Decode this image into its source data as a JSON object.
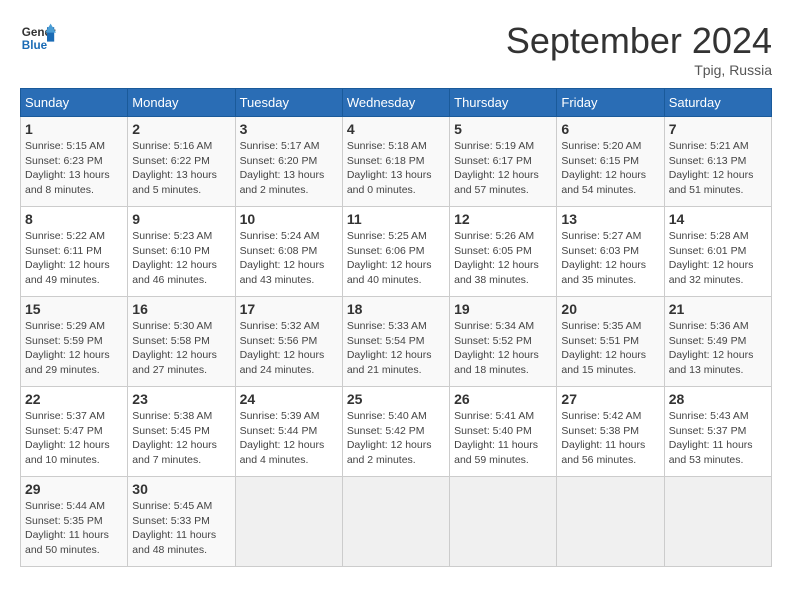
{
  "header": {
    "logo_line1": "General",
    "logo_line2": "Blue",
    "month_title": "September 2024",
    "location": "Tpig, Russia"
  },
  "weekdays": [
    "Sunday",
    "Monday",
    "Tuesday",
    "Wednesday",
    "Thursday",
    "Friday",
    "Saturday"
  ],
  "weeks": [
    [
      {
        "day": "1",
        "info": "Sunrise: 5:15 AM\nSunset: 6:23 PM\nDaylight: 13 hours\nand 8 minutes."
      },
      {
        "day": "2",
        "info": "Sunrise: 5:16 AM\nSunset: 6:22 PM\nDaylight: 13 hours\nand 5 minutes."
      },
      {
        "day": "3",
        "info": "Sunrise: 5:17 AM\nSunset: 6:20 PM\nDaylight: 13 hours\nand 2 minutes."
      },
      {
        "day": "4",
        "info": "Sunrise: 5:18 AM\nSunset: 6:18 PM\nDaylight: 13 hours\nand 0 minutes."
      },
      {
        "day": "5",
        "info": "Sunrise: 5:19 AM\nSunset: 6:17 PM\nDaylight: 12 hours\nand 57 minutes."
      },
      {
        "day": "6",
        "info": "Sunrise: 5:20 AM\nSunset: 6:15 PM\nDaylight: 12 hours\nand 54 minutes."
      },
      {
        "day": "7",
        "info": "Sunrise: 5:21 AM\nSunset: 6:13 PM\nDaylight: 12 hours\nand 51 minutes."
      }
    ],
    [
      {
        "day": "8",
        "info": "Sunrise: 5:22 AM\nSunset: 6:11 PM\nDaylight: 12 hours\nand 49 minutes."
      },
      {
        "day": "9",
        "info": "Sunrise: 5:23 AM\nSunset: 6:10 PM\nDaylight: 12 hours\nand 46 minutes."
      },
      {
        "day": "10",
        "info": "Sunrise: 5:24 AM\nSunset: 6:08 PM\nDaylight: 12 hours\nand 43 minutes."
      },
      {
        "day": "11",
        "info": "Sunrise: 5:25 AM\nSunset: 6:06 PM\nDaylight: 12 hours\nand 40 minutes."
      },
      {
        "day": "12",
        "info": "Sunrise: 5:26 AM\nSunset: 6:05 PM\nDaylight: 12 hours\nand 38 minutes."
      },
      {
        "day": "13",
        "info": "Sunrise: 5:27 AM\nSunset: 6:03 PM\nDaylight: 12 hours\nand 35 minutes."
      },
      {
        "day": "14",
        "info": "Sunrise: 5:28 AM\nSunset: 6:01 PM\nDaylight: 12 hours\nand 32 minutes."
      }
    ],
    [
      {
        "day": "15",
        "info": "Sunrise: 5:29 AM\nSunset: 5:59 PM\nDaylight: 12 hours\nand 29 minutes."
      },
      {
        "day": "16",
        "info": "Sunrise: 5:30 AM\nSunset: 5:58 PM\nDaylight: 12 hours\nand 27 minutes."
      },
      {
        "day": "17",
        "info": "Sunrise: 5:32 AM\nSunset: 5:56 PM\nDaylight: 12 hours\nand 24 minutes."
      },
      {
        "day": "18",
        "info": "Sunrise: 5:33 AM\nSunset: 5:54 PM\nDaylight: 12 hours\nand 21 minutes."
      },
      {
        "day": "19",
        "info": "Sunrise: 5:34 AM\nSunset: 5:52 PM\nDaylight: 12 hours\nand 18 minutes."
      },
      {
        "day": "20",
        "info": "Sunrise: 5:35 AM\nSunset: 5:51 PM\nDaylight: 12 hours\nand 15 minutes."
      },
      {
        "day": "21",
        "info": "Sunrise: 5:36 AM\nSunset: 5:49 PM\nDaylight: 12 hours\nand 13 minutes."
      }
    ],
    [
      {
        "day": "22",
        "info": "Sunrise: 5:37 AM\nSunset: 5:47 PM\nDaylight: 12 hours\nand 10 minutes."
      },
      {
        "day": "23",
        "info": "Sunrise: 5:38 AM\nSunset: 5:45 PM\nDaylight: 12 hours\nand 7 minutes."
      },
      {
        "day": "24",
        "info": "Sunrise: 5:39 AM\nSunset: 5:44 PM\nDaylight: 12 hours\nand 4 minutes."
      },
      {
        "day": "25",
        "info": "Sunrise: 5:40 AM\nSunset: 5:42 PM\nDaylight: 12 hours\nand 2 minutes."
      },
      {
        "day": "26",
        "info": "Sunrise: 5:41 AM\nSunset: 5:40 PM\nDaylight: 11 hours\nand 59 minutes."
      },
      {
        "day": "27",
        "info": "Sunrise: 5:42 AM\nSunset: 5:38 PM\nDaylight: 11 hours\nand 56 minutes."
      },
      {
        "day": "28",
        "info": "Sunrise: 5:43 AM\nSunset: 5:37 PM\nDaylight: 11 hours\nand 53 minutes."
      }
    ],
    [
      {
        "day": "29",
        "info": "Sunrise: 5:44 AM\nSunset: 5:35 PM\nDaylight: 11 hours\nand 50 minutes."
      },
      {
        "day": "30",
        "info": "Sunrise: 5:45 AM\nSunset: 5:33 PM\nDaylight: 11 hours\nand 48 minutes."
      },
      {
        "day": "",
        "info": ""
      },
      {
        "day": "",
        "info": ""
      },
      {
        "day": "",
        "info": ""
      },
      {
        "day": "",
        "info": ""
      },
      {
        "day": "",
        "info": ""
      }
    ]
  ]
}
